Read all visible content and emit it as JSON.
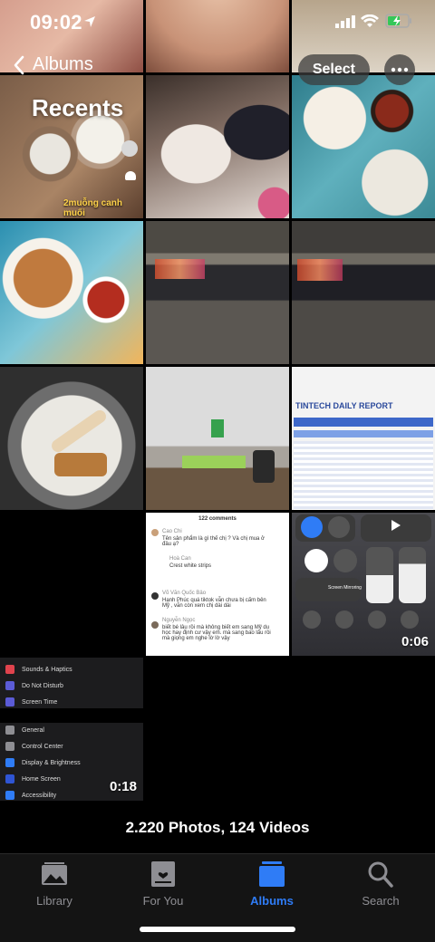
{
  "status": {
    "time": "09:02"
  },
  "nav": {
    "back_label": "Albums",
    "title": "Recents",
    "select_label": "Select"
  },
  "tiles": {
    "r1c1_caption": "2muỗng canh muối",
    "r2c3_report_title": "TINTECH DAILY REPORT",
    "comments": {
      "header": "122 comments",
      "c1_author": "Cao Chi",
      "c1_text": "Tên sản phẩm là gì thế chị ? Và chị mua ở đâu ạ?",
      "c2_author": "Hoà Can",
      "c2_text": "Crest white strips",
      "c3_author": "Võ Văn Quốc Bảo",
      "c3_text": "Hạnh Phúc quá tiktok vẫn chưa bị cấm bên Mỹ , vẫn còn xem chị dài dài",
      "c4_author": "Nguyễn Ngọc",
      "c4_text": "biết bé lâu rồi mà không biết em sang Mỹ du học hay định cư vậy em. mà sang bao lâu rồi mà giọng em nghe lờ lờ vậy"
    },
    "control_center": {
      "duration": "0:06",
      "screen_mirroring": "Screen Mirroring"
    },
    "settings": {
      "duration": "0:18",
      "items": [
        "Sounds & Haptics",
        "Do Not Disturb",
        "Screen Time",
        "General",
        "Control Center",
        "Display & Brightness",
        "Home Screen",
        "Accessibility"
      ]
    }
  },
  "library_count": "2.220 Photos, 124 Videos",
  "tabbar": {
    "tabs": [
      {
        "label": "Library",
        "icon": "library-icon"
      },
      {
        "label": "For You",
        "icon": "for-you-icon"
      },
      {
        "label": "Albums",
        "icon": "albums-icon",
        "active": true
      },
      {
        "label": "Search",
        "icon": "search-icon"
      }
    ]
  },
  "colors": {
    "accent": "#2f7cf6",
    "background": "#000000",
    "tabbar": "#141414"
  }
}
